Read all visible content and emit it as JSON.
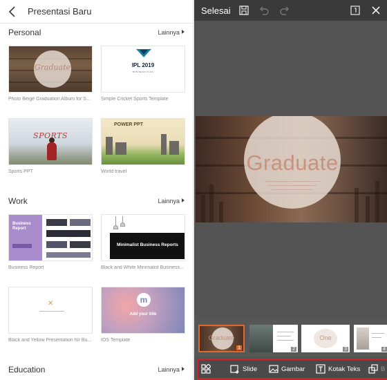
{
  "left": {
    "header": {
      "title": "Presentasi Baru"
    },
    "more_label": "Lainnya",
    "sections": [
      {
        "title": "Personal",
        "cards": [
          {
            "caption": "Photo Beige Graduation Album for S...",
            "thumb_text": "Graduate"
          },
          {
            "caption": "Simple Cricket Sports Template",
            "thumb_text": "IPL 2019",
            "thumb_sub": "BUSINESS PLAN"
          },
          {
            "caption": "Sports PPT",
            "thumb_text": "SPORTS"
          },
          {
            "caption": "World travel",
            "thumb_text": "POWER PPT"
          }
        ]
      },
      {
        "title": "Work",
        "cards": [
          {
            "caption": "Business Report",
            "thumb_text": "Business Report"
          },
          {
            "caption": "Black and White Minimalist Business...",
            "thumb_text": "Minimalist Business Reports"
          },
          {
            "caption": "Black and Yellow Presentation for Bu...",
            "thumb_text": "✕"
          },
          {
            "caption": "IOS Template",
            "thumb_text": "Add your title",
            "thumb_mark": "m"
          }
        ]
      },
      {
        "title": "Education",
        "cards": []
      }
    ]
  },
  "right": {
    "top": {
      "done_label": "Selesai"
    },
    "slide": {
      "main_text": "Graduate"
    },
    "thumbnails": [
      {
        "number": "1",
        "text": "Graduate",
        "selected": true
      },
      {
        "number": "2",
        "text": ""
      },
      {
        "number": "3",
        "text": "One"
      },
      {
        "number": "4",
        "text": ""
      }
    ],
    "toolbar": {
      "slide_label": "Slide",
      "image_label": "Gambar",
      "textbox_label": "Kotak Teks",
      "shape_label": "B"
    },
    "colors": {
      "accent": "#e0692b",
      "highlight": "#d3202a",
      "panel": "#545454"
    }
  }
}
